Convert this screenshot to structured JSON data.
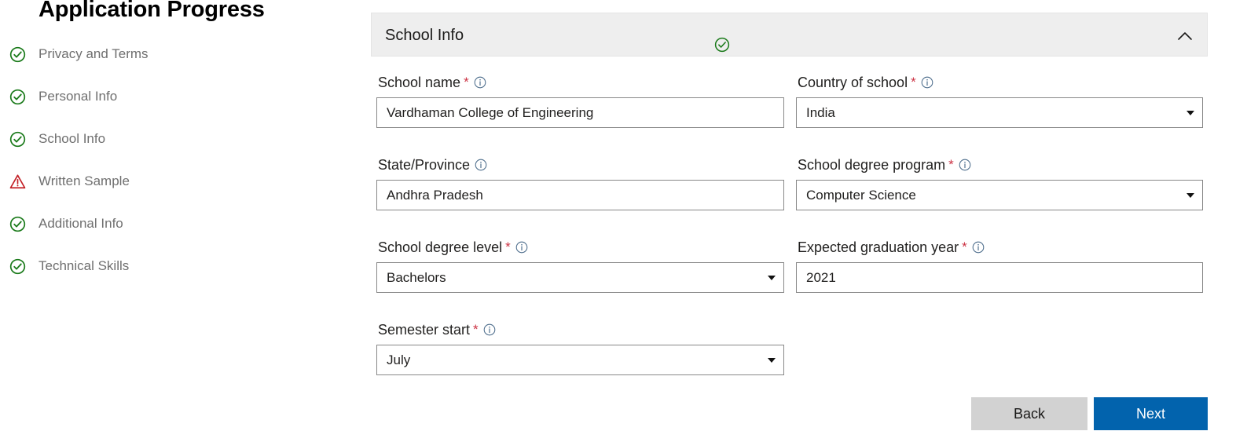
{
  "progress": {
    "title": "Application Progress",
    "items": [
      {
        "label": "Privacy and Terms",
        "status": "complete"
      },
      {
        "label": "Personal Info",
        "status": "complete"
      },
      {
        "label": "School Info",
        "status": "complete"
      },
      {
        "label": "Written Sample",
        "status": "warning"
      },
      {
        "label": "Additional Info",
        "status": "complete"
      },
      {
        "label": "Technical Skills",
        "status": "complete"
      }
    ]
  },
  "panel": {
    "title": "School Info",
    "status": "complete",
    "collapse_icon": "chevron-up-icon",
    "expanded": true
  },
  "form": {
    "fields": [
      {
        "name": "school-name",
        "label": "School name",
        "required": true,
        "info_icon": "info-circle-icon",
        "control": "text",
        "value": "Vardhaman College of Engineering",
        "column": "left",
        "row": 0
      },
      {
        "name": "country-of-school",
        "label": "Country of school",
        "required": true,
        "info_icon": "info-circle-icon",
        "control": "select",
        "value": "India",
        "column": "right",
        "row": 0
      },
      {
        "name": "state-province",
        "label": "State/Province",
        "required": false,
        "info_icon": "info-circle-icon",
        "control": "text",
        "value": "Andhra Pradesh",
        "column": "left",
        "row": 1
      },
      {
        "name": "school-degree-program",
        "label": "School degree program",
        "required": true,
        "info_icon": "info-circle-icon",
        "control": "select",
        "value": "Computer Science",
        "column": "right",
        "row": 1
      },
      {
        "name": "school-degree-level",
        "label": "School degree level",
        "required": true,
        "info_icon": "info-circle-icon",
        "control": "select",
        "value": "Bachelors",
        "column": "left",
        "row": 2
      },
      {
        "name": "expected-graduation-year",
        "label": "Expected graduation year",
        "required": true,
        "info_icon": "info-circle-icon",
        "control": "text",
        "value": "2021",
        "column": "right",
        "row": 2
      },
      {
        "name": "semester-start",
        "label": "Semester start",
        "required": true,
        "info_icon": "info-circle-icon",
        "control": "select",
        "value": "July",
        "column": "left",
        "row": 3
      }
    ]
  },
  "footer": {
    "back_label": "Back",
    "next_label": "Next"
  },
  "colors": {
    "complete_green": "#1a7a1a",
    "warning_red": "#c32026",
    "required_star": "#cc3344",
    "info_icon": "#4a6b8a",
    "primary_button": "#0263ad",
    "secondary_button": "#d2d2d2",
    "panel_header": "#eeeeee",
    "label_text": "#6f6f6f"
  }
}
